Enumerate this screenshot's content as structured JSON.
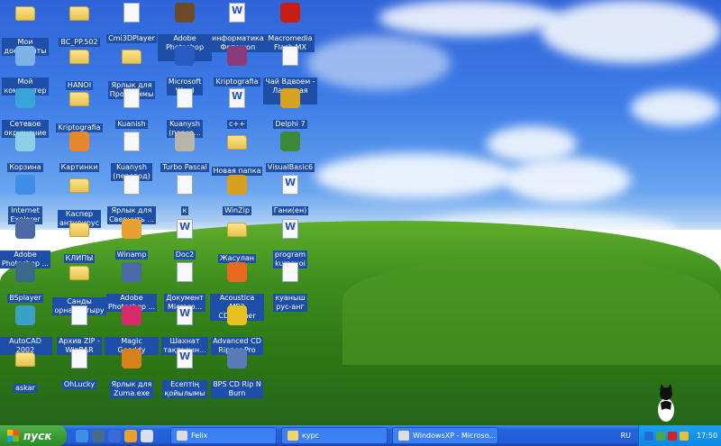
{
  "desktop": {
    "icons": [
      [
        {
          "label": "Мои\nдокументы",
          "icon": "my-documents",
          "type": "folder"
        },
        {
          "label": "BC_PP.502",
          "icon": "folder",
          "type": "folder"
        },
        {
          "label": "Cmi3DPlayer",
          "icon": "cmi3dplayer",
          "type": "doc"
        },
        {
          "label": "Adobe\nPhotoshop 7.0",
          "icon": "photoshop",
          "type": "app",
          "color": "#6b4a2a"
        },
        {
          "label": "информатика\nФотошоп",
          "icon": "word-document",
          "type": "word"
        },
        {
          "label": "Macromedia\nFlash MX",
          "icon": "flash",
          "type": "app",
          "color": "#c81d12"
        }
      ],
      [
        {
          "label": "Мой\nкомпьютер",
          "icon": "my-computer",
          "type": "app",
          "color": "#7db3e8"
        },
        {
          "label": "HANOI",
          "icon": "folder",
          "type": "folder"
        },
        {
          "label": "Ярлык для\nПрограммы",
          "icon": "folder-shortcut",
          "type": "folder"
        },
        {
          "label": "Microsoft\nWord",
          "icon": "word",
          "type": "app",
          "color": "#2a5bc2"
        },
        {
          "label": "Kriptografia",
          "icon": "winrar-archive",
          "type": "app",
          "color": "#8a3a78"
        },
        {
          "label": "Чай Вдвоем -\nЛасковая моя",
          "icon": "audio-file",
          "type": "doc"
        }
      ],
      [
        {
          "label": "Сетевое\nокружение",
          "icon": "network-places",
          "type": "app",
          "color": "#3aa4d8"
        },
        {
          "label": "Kriptografia",
          "icon": "folder",
          "type": "folder"
        },
        {
          "label": "Kuanish",
          "icon": "text-file",
          "type": "doc"
        },
        {
          "label": "Kuanysh\n(перев...",
          "icon": "text-file",
          "type": "doc"
        },
        {
          "label": "c++",
          "icon": "word-document",
          "type": "word"
        },
        {
          "label": "Delphi 7",
          "icon": "delphi",
          "type": "app",
          "color": "#d8a21e"
        }
      ],
      [
        {
          "label": "Корзина",
          "icon": "recycle-bin",
          "type": "app",
          "color": "#8fd0e8"
        },
        {
          "label": "Картинки",
          "icon": "pictures",
          "type": "app",
          "color": "#e8862a"
        },
        {
          "label": "Kuanysh\n(перевод)",
          "icon": "text-file",
          "type": "doc"
        },
        {
          "label": "Turbo Pascal",
          "icon": "turbo-pascal",
          "type": "app",
          "color": "#b8b4a8"
        },
        {
          "label": "Новая папка",
          "icon": "folder",
          "type": "folder"
        },
        {
          "label": "VisualBasic6",
          "icon": "visual-basic",
          "type": "app",
          "color": "#3a8a3a"
        }
      ],
      [
        {
          "label": "Internet\nExplorer",
          "icon": "internet-explorer",
          "type": "app",
          "color": "#3e8ee8"
        },
        {
          "label": "Каспер\nантивирус",
          "icon": "folder",
          "type": "folder"
        },
        {
          "label": "Ярлык для\nСвернуть ...",
          "icon": "shortcut",
          "type": "doc"
        },
        {
          "label": "к",
          "icon": "text-file",
          "type": "doc"
        },
        {
          "label": "WinZip",
          "icon": "winzip",
          "type": "app",
          "color": "#d8a020"
        },
        {
          "label": "Гани(ен)",
          "icon": "word-document",
          "type": "word"
        }
      ],
      [
        {
          "label": "Adobe\nPhotoshop ...",
          "icon": "photoshop",
          "type": "app",
          "color": "#4a6aa8"
        },
        {
          "label": "КЛИПЫ",
          "icon": "folder",
          "type": "folder"
        },
        {
          "label": "Winamp",
          "icon": "winamp",
          "type": "app",
          "color": "#e8a030"
        },
        {
          "label": "Doc2",
          "icon": "word-document",
          "type": "word"
        },
        {
          "label": "Жасулан",
          "icon": "folder-shortcut",
          "type": "folder"
        },
        {
          "label": "program\nkursovoi",
          "icon": "word-document",
          "type": "word"
        }
      ],
      [
        {
          "label": "BSplayer",
          "icon": "bsplayer",
          "type": "app",
          "color": "#3a6a8a"
        },
        {
          "label": "Санды\nорналастыру",
          "icon": "folder",
          "type": "folder"
        },
        {
          "label": "Adobe\nPhotoshop ...",
          "icon": "photoshop",
          "type": "app",
          "color": "#4a6aa8"
        },
        {
          "label": "Документ\nMicroso...",
          "icon": "document",
          "type": "doc"
        },
        {
          "label": "Acoustica MP3\nCD Burner",
          "icon": "cd-burner",
          "type": "app",
          "color": "#e86a20"
        },
        {
          "label": "куаныш\nрус-анг",
          "icon": "text-file",
          "type": "doc"
        }
      ],
      [
        {
          "label": "AutoCAD 2002",
          "icon": "autocad",
          "type": "app",
          "color": "#3aa0c8"
        },
        {
          "label": "Архив ZIP -\nWinRAR",
          "icon": "zip-archive",
          "type": "doc"
        },
        {
          "label": "Magic Gooddy",
          "icon": "magic-gooddy",
          "type": "app",
          "color": "#d82a6a"
        },
        {
          "label": "Шахнат\nтақтасын...",
          "icon": "word-document",
          "type": "word"
        },
        {
          "label": "Advanced CD\nRipper Pro",
          "icon": "cd-ripper",
          "type": "app",
          "color": "#e8c020"
        }
      ],
      [
        {
          "label": "askar",
          "icon": "folder",
          "type": "folder"
        },
        {
          "label": "OhLucky",
          "icon": "ohlucky",
          "type": "doc"
        },
        {
          "label": "Ярлык для\nZuma.exe",
          "icon": "zuma",
          "type": "app",
          "color": "#d8801a"
        },
        {
          "label": "Есептің\nқойылымы",
          "icon": "word-document",
          "type": "word"
        },
        {
          "label": "BPS CD Rip N\nBurn",
          "icon": "cd-rip-burn",
          "type": "app",
          "color": "#5a7ab8"
        }
      ]
    ]
  },
  "taskbar": {
    "start_label": "пуск",
    "quick_launch": [
      {
        "icon": "internet-explorer",
        "color": "#3e8ee8"
      },
      {
        "icon": "media-player",
        "color": "#4a6a8a"
      },
      {
        "icon": "show-desktop",
        "color": "#3a6ad8"
      },
      {
        "icon": "winamp",
        "color": "#e8a030"
      },
      {
        "icon": "messenger",
        "color": "#d8e0f0"
      }
    ],
    "tasks": [
      {
        "label": "Felix",
        "icon": "felix"
      },
      {
        "label": "курс",
        "icon": "folder"
      },
      {
        "label": "WindowsXP - Microso...",
        "icon": "word"
      }
    ],
    "language": "RU",
    "tray": [
      {
        "icon": "arrow",
        "color": "#2a6ad8"
      },
      {
        "icon": "network",
        "color": "#4aa84a"
      },
      {
        "icon": "kaspersky",
        "color": "#d82020"
      },
      {
        "icon": "monitor",
        "color": "#e8c030"
      }
    ],
    "clock": "17:50"
  }
}
